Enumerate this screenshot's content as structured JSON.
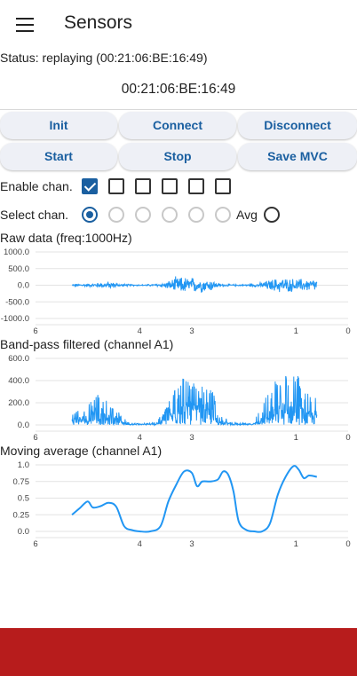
{
  "app": {
    "title": "Sensors"
  },
  "status": {
    "text": "Status: replaying (00:21:06:BE:16:49)",
    "device": "00:21:06:BE:16:49"
  },
  "buttons": {
    "init": "Init",
    "connect": "Connect",
    "disconnect": "Disconnect",
    "start": "Start",
    "stop": "Stop",
    "save_mvc": "Save MVC"
  },
  "channels": {
    "enable_label": "Enable chan.",
    "enabled": [
      true,
      false,
      false,
      false,
      false,
      false
    ],
    "select_label": "Select chan.",
    "selected_index": 0,
    "avg_label": "Avg",
    "avg_selected": false
  },
  "colors": {
    "accent": "#1a5fa0",
    "line": "#2196f3",
    "grid": "#e3e3e3",
    "bottom_bar": "#b71c1c"
  },
  "chart_data": [
    {
      "type": "line",
      "title": "Raw data (freq:1000Hz)",
      "ylim": [
        -1000,
        1000
      ],
      "yticks": [
        1000,
        500,
        0,
        -500,
        -1000
      ],
      "ytick_labels": [
        "1000.0",
        "500.0",
        "0.0",
        "-500.0",
        "-1000.0"
      ],
      "xlim": [
        6,
        0
      ],
      "xticks": [
        6,
        4,
        3,
        1,
        0
      ],
      "xtick_labels": [
        "6",
        "4",
        "3",
        "1",
        "0"
      ],
      "x_start": 5.3,
      "x_end": 0.6,
      "envelope": [
        [
          5.3,
          40
        ],
        [
          4.9,
          60
        ],
        [
          4.6,
          130
        ],
        [
          4.3,
          40
        ],
        [
          4.0,
          20
        ],
        [
          3.8,
          30
        ],
        [
          3.5,
          100
        ],
        [
          3.3,
          290
        ],
        [
          3.0,
          280
        ],
        [
          2.8,
          250
        ],
        [
          2.6,
          200
        ],
        [
          2.5,
          60
        ],
        [
          2.2,
          30
        ],
        [
          2.0,
          25
        ],
        [
          1.85,
          50
        ],
        [
          1.7,
          80
        ],
        [
          1.5,
          200
        ],
        [
          1.3,
          260
        ],
        [
          1.1,
          230
        ],
        [
          0.8,
          220
        ],
        [
          0.6,
          220
        ]
      ]
    },
    {
      "type": "line",
      "title": "Band-pass filtered (channel A1)",
      "ylim": [
        0,
        600
      ],
      "yticks": [
        600,
        400,
        200,
        0
      ],
      "ytick_labels": [
        "600.0",
        "400.0",
        "200.0",
        "0.0"
      ],
      "xlim": [
        6,
        0
      ],
      "xticks": [
        6,
        4,
        3,
        1,
        0
      ],
      "xtick_labels": [
        "6",
        "4",
        "3",
        "1",
        "0"
      ],
      "x_start": 5.3,
      "x_end": 0.6,
      "envelope": [
        [
          5.3,
          150
        ],
        [
          5.0,
          200
        ],
        [
          4.8,
          290
        ],
        [
          4.6,
          200
        ],
        [
          4.4,
          120
        ],
        [
          4.2,
          20
        ],
        [
          4.0,
          15
        ],
        [
          3.7,
          25
        ],
        [
          3.5,
          150
        ],
        [
          3.3,
          420
        ],
        [
          3.0,
          480
        ],
        [
          2.8,
          350
        ],
        [
          2.6,
          330
        ],
        [
          2.5,
          100
        ],
        [
          2.2,
          20
        ],
        [
          1.9,
          15
        ],
        [
          1.8,
          40
        ],
        [
          1.6,
          250
        ],
        [
          1.4,
          410
        ],
        [
          1.2,
          470
        ],
        [
          1.0,
          500
        ],
        [
          0.8,
          280
        ],
        [
          0.6,
          300
        ]
      ]
    },
    {
      "type": "line",
      "title": "Moving average (channel A1)",
      "ylim": [
        0,
        1.0
      ],
      "yticks": [
        1.0,
        0.75,
        0.5,
        0.25,
        0.0
      ],
      "ytick_labels": [
        "1.0",
        "0.75",
        "0.5",
        "0.25",
        "0.0"
      ],
      "xlim": [
        6,
        0
      ],
      "xticks": [
        6,
        4,
        3,
        1,
        0
      ],
      "xtick_labels": [
        "6",
        "4",
        "3",
        "1",
        "0"
      ],
      "x": [
        5.3,
        5.15,
        5.0,
        4.9,
        4.75,
        4.6,
        4.45,
        4.3,
        4.15,
        4.0,
        3.8,
        3.6,
        3.45,
        3.3,
        3.15,
        3.0,
        2.9,
        2.8,
        2.65,
        2.5,
        2.4,
        2.3,
        2.2,
        2.1,
        1.95,
        1.8,
        1.65,
        1.5,
        1.35,
        1.2,
        1.05,
        0.95,
        0.85,
        0.75,
        0.6
      ],
      "y": [
        0.25,
        0.35,
        0.45,
        0.36,
        0.38,
        0.43,
        0.37,
        0.08,
        0.02,
        0.0,
        0.0,
        0.08,
        0.45,
        0.7,
        0.9,
        0.88,
        0.68,
        0.75,
        0.75,
        0.78,
        0.9,
        0.85,
        0.6,
        0.15,
        0.02,
        0.0,
        0.0,
        0.12,
        0.55,
        0.82,
        0.98,
        0.93,
        0.8,
        0.84,
        0.82
      ]
    }
  ]
}
